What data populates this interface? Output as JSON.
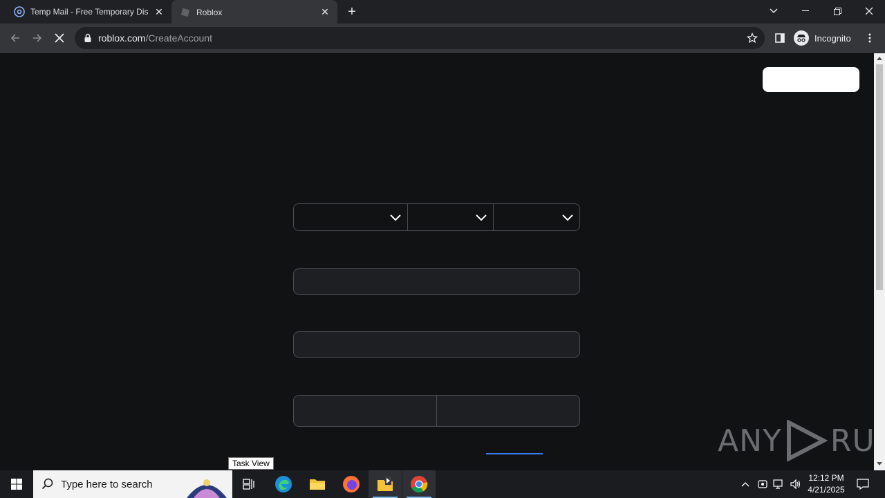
{
  "browser": {
    "tabs": [
      {
        "title": "Temp Mail - Free Temporary Disp",
        "icon": "at-sign-icon",
        "active": false
      },
      {
        "title": "Roblox",
        "icon": "roblox-icon",
        "active": true
      }
    ],
    "url": {
      "domain": "roblox.com",
      "path": "/CreateAccount"
    },
    "profile_label": "Incognito"
  },
  "tooltip": {
    "text": "Task View"
  },
  "taskbar": {
    "search_placeholder": "Type here to search",
    "clock": {
      "time": "12:12 PM",
      "date": "4/21/2025"
    }
  },
  "watermark": {
    "left": "ANY",
    "right": "RUN"
  },
  "colors": {
    "page_bg": "#111214",
    "field_border": "#4b4d52",
    "accent": "#3b7bf5"
  }
}
